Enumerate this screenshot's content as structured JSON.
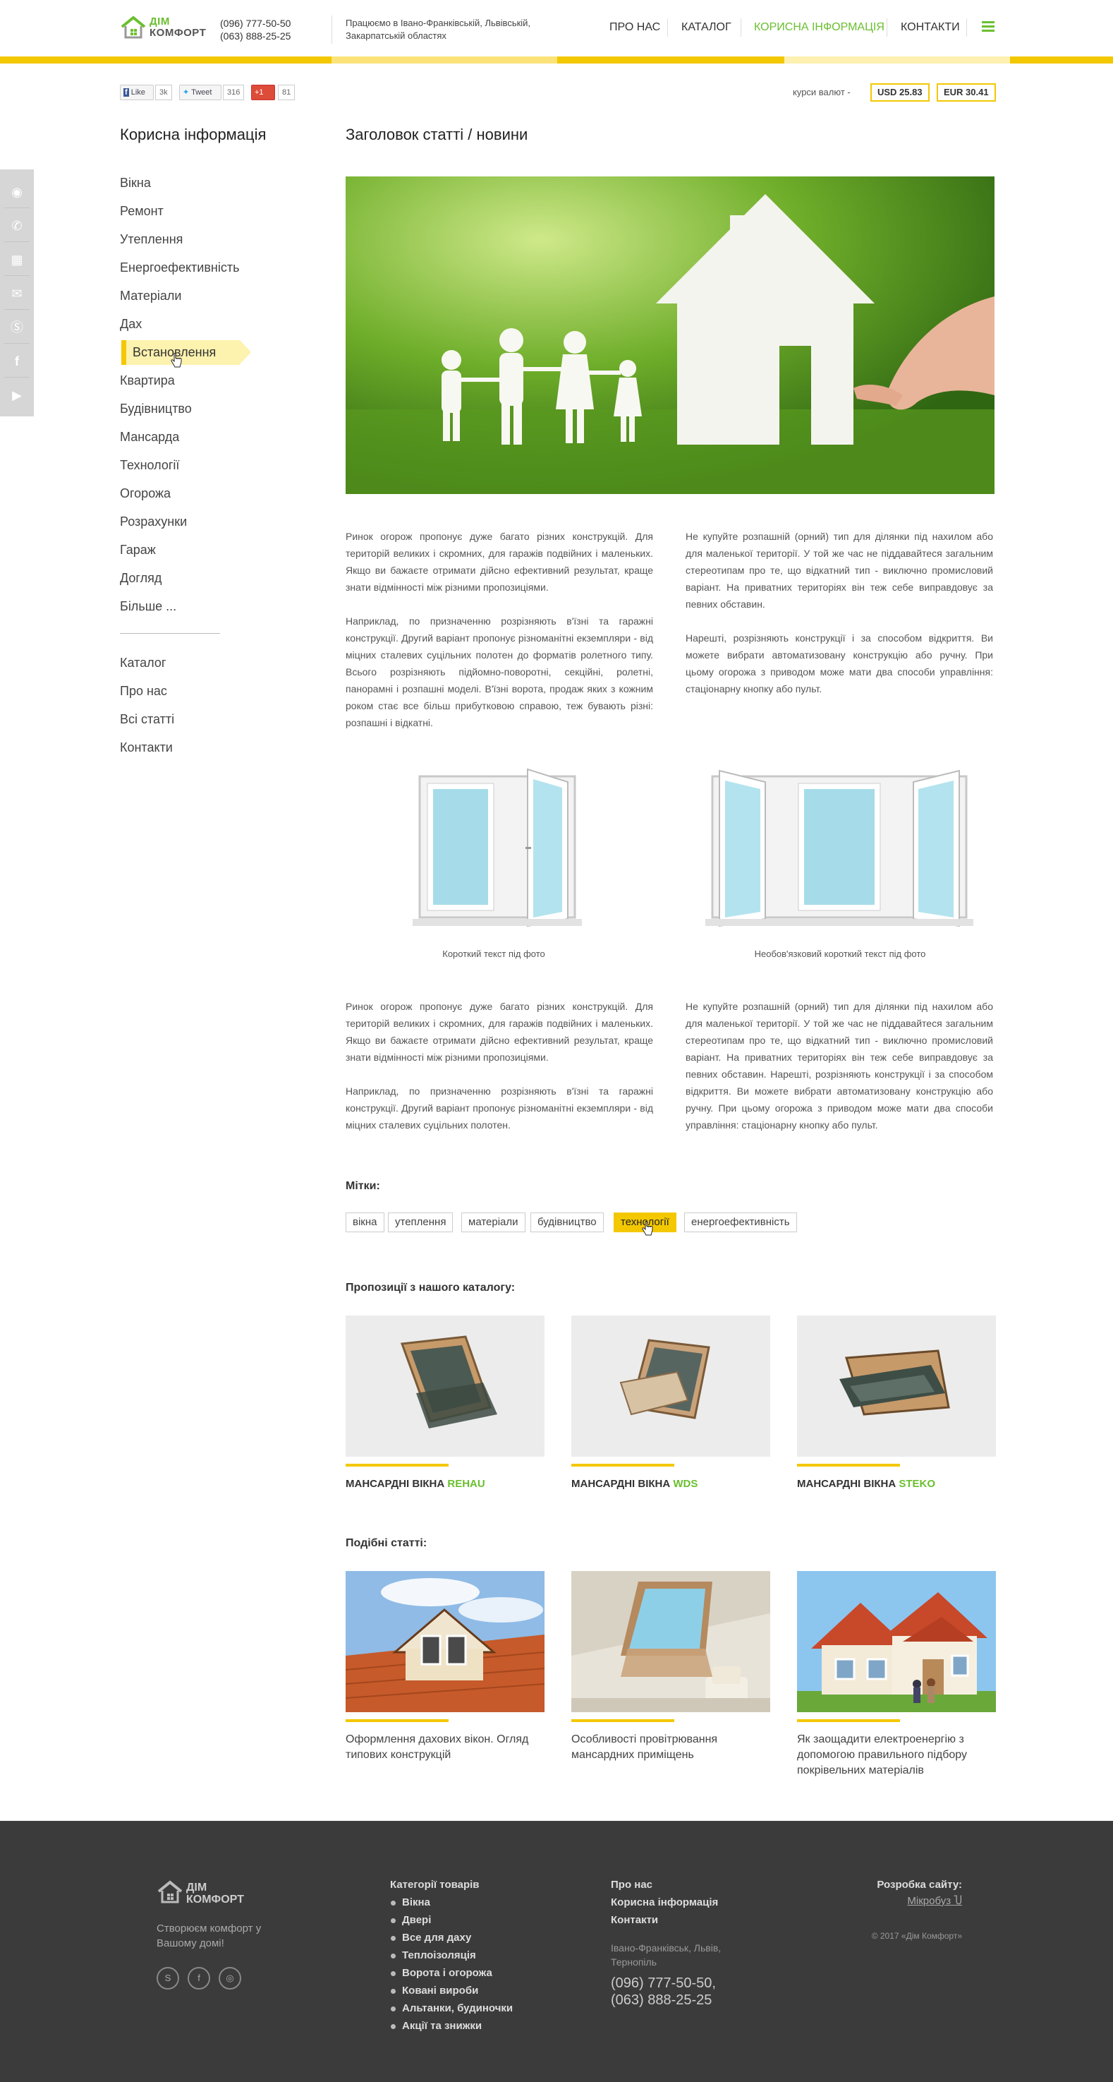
{
  "header": {
    "logo_line1": "ДІМ",
    "logo_line2": "КОМФОРТ",
    "phone1": "(096) 777-50-50",
    "phone2": "(063) 888-25-25",
    "region": "Працюємо в Івано-Франківській, Львівській, Закарпатській областях",
    "nav": [
      "ПРО НАС",
      "КАТАЛОГ",
      "КОРИСНА ІНФОРМАЦІЯ",
      "КОНТАКТИ"
    ],
    "accent_yellow": "#f3c800",
    "accent_green": "#6abf2e"
  },
  "social": {
    "like_label": "Like",
    "like_count": "3k",
    "tweet_label": "Tweet",
    "tweet_count": "316",
    "gplus_label": "+1",
    "gplus_count": "81"
  },
  "rates": {
    "label": "курси валют -",
    "usd": "USD 25.83",
    "eur": "EUR 30.41"
  },
  "sidebar": {
    "title": "Корисна інформація",
    "items": [
      "Вікна",
      "Ремонт",
      "Утеплення",
      "Енергоефективність",
      "Матеріали",
      "Дах",
      "Встановлення",
      "Квартира",
      "Будівництво",
      "Мансарда",
      "Технології",
      "Огорожа",
      "Розрахунки",
      "Гараж",
      "Догляд",
      "Більше ..."
    ],
    "links": [
      "Каталог",
      "Про нас",
      "Всі статті",
      "Контакти"
    ]
  },
  "article": {
    "title": "Заголовок статті / новини",
    "p1": "Ринок огорож пропонує дуже багато різних конструкцій. Для територій великих і скромних, для гаражів подвійних і маленьких. Якщо ви бажаєте отримати дійсно ефективний результат, краще знати відмінності між різними пропозиціями.",
    "p2": "Наприклад, по призначенню розрізняють в'їзні та гаражні конструкції. Другий варіант пропонує різноманітні екземпляри - від міцних сталевих суцільних полотен до форматів ролетного типу. Всього розрізняють підйомно-поворотні, секційні, ролетні, панорамні і розпашні моделі. В'їзні ворота, продаж яких з кожним роком стає все більш прибутковою справою, теж бувають різні: розпашні і відкатні.",
    "p3": "Не купуйте розпашній (орний) тип для ділянки під нахилом або для маленької території. У той же час не піддавайтеся загальним стереотипам про те, що відкатний тип - виключно промисловий варіант. На приватних територіях він теж себе виправдовує за певних обставин.",
    "p4": "Нарешті, розрізняють конструкції і за способом відкриття. Ви можете вибрати автоматизовану конструкцію або ручну. При цьому огорожа з приводом може мати два способи управління: стаціонарну кнопку або пульт.",
    "caption1": "Короткий текст під фото",
    "caption2": "Необов'язковий короткий текст під фото",
    "p5": "Ринок огорож пропонує дуже багато різних конструкцій. Для територій великих і скромних, для гаражів подвійних і маленьких. Якщо ви бажаєте отримати дійсно ефективний результат, краще знати відмінності між різними пропозиціями.",
    "p6": "Наприклад, по призначенню розрізняють в'їзні та гаражні конструкції. Другий варіант пропонує різноманітні екземпляри - від міцних сталевих суцільних полотен.",
    "p7": "Не купуйте розпашній (орний) тип для ділянки під нахилом або для маленької території. У той же час не піддавайтеся загальним стереотипам про те, що відкатний тип - виключно промисловий варіант. На приватних територіях він теж себе виправдовує за певних обставин. Нарешті, розрізняють конструкції і за способом відкриття. Ви можете вибрати автоматизовану конструкцію або ручну. При цьому огорожа з приводом може мати два способи управління: стаціонарну кнопку або пульт."
  },
  "tags": {
    "title": "Мітки:",
    "items": [
      "вікна",
      "утеплення",
      "матеріали",
      "будівництво",
      "технології",
      "енергоефективність"
    ],
    "active": "технології"
  },
  "catalog": {
    "title": "Пропозиції з нашого каталогу:",
    "prefix": "МАНСАРДНІ ВІКНА",
    "brands": [
      "REHAU",
      "WDS",
      "STEKO"
    ]
  },
  "similar": {
    "title": "Подібні статті:",
    "items": [
      "Оформлення дахових вікон. Огляд типових конструкцій",
      "Особливості провітрювання мансардних приміщень",
      "Як заощадити електроенергію з допомогою правильного підбору покрівельних матеріалів"
    ]
  },
  "footer": {
    "logo_line1": "ДІМ",
    "logo_line2": "КОМФОРТ",
    "slogan": "Створюєм комфорт у Вашому домі!",
    "categories_title": "Категорії товарів",
    "categories": [
      "Вікна",
      "Двері",
      "Все для даху",
      "Теплоізоляція",
      "Ворота і огорожа",
      "Ковані вироби",
      "Альтанки, будиночки",
      "Акції та знижки"
    ],
    "links": [
      "Про нас",
      "Корисна інформація",
      "Контакти"
    ],
    "address": "Івано-Франківськ, Львів, Тернопіль",
    "phone1": "(096) 777-50-50,",
    "phone2": "(063) 888-25-25",
    "dev_label": "Розробка сайту:",
    "dev_name": "Мікробуз",
    "copyright": "© 2017 «Дім Комфорт»"
  }
}
